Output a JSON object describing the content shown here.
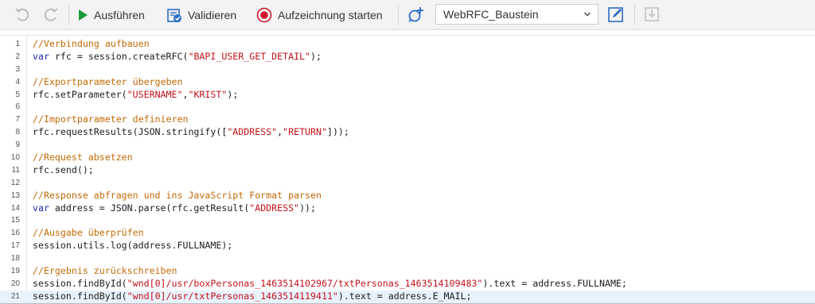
{
  "toolbar": {
    "run_label": "Ausführen",
    "validate_label": "Validieren",
    "record_label": "Aufzeichnung starten",
    "module_select_value": "WebRFC_Baustein"
  },
  "colors": {
    "comment": "#c16a06",
    "keyword": "#1b2fb0",
    "string": "#c1121a",
    "run_green": "#1a9b3a",
    "record_red": "#d0182a",
    "accent_blue": "#2b6cc4",
    "active_line": "#e8f2fc"
  },
  "editor": {
    "active_line": 21,
    "lines": [
      {
        "n": "1",
        "tokens": [
          {
            "t": "//Verbindung aufbauen",
            "c": "comment"
          }
        ]
      },
      {
        "n": "2",
        "tokens": [
          {
            "t": "var",
            "c": "kw"
          },
          {
            "t": " rfc = session.createRFC(",
            "c": ""
          },
          {
            "t": "\"BAPI_USER_GET_DETAIL\"",
            "c": "str"
          },
          {
            "t": ");",
            "c": ""
          }
        ]
      },
      {
        "n": "3",
        "tokens": []
      },
      {
        "n": "4",
        "tokens": [
          {
            "t": "//Exportparameter übergeben",
            "c": "comment"
          }
        ]
      },
      {
        "n": "5",
        "tokens": [
          {
            "t": "rfc.setParameter(",
            "c": ""
          },
          {
            "t": "\"USERNAME\"",
            "c": "str"
          },
          {
            "t": ",",
            "c": ""
          },
          {
            "t": "\"KRIST\"",
            "c": "str"
          },
          {
            "t": ");",
            "c": ""
          }
        ]
      },
      {
        "n": "6",
        "tokens": []
      },
      {
        "n": "7",
        "tokens": [
          {
            "t": "//Importparameter definieren",
            "c": "comment"
          }
        ]
      },
      {
        "n": "8",
        "tokens": [
          {
            "t": "rfc.requestResults(JSON.stringify([",
            "c": ""
          },
          {
            "t": "\"ADDRESS\"",
            "c": "str"
          },
          {
            "t": ",",
            "c": ""
          },
          {
            "t": "\"RETURN\"",
            "c": "str"
          },
          {
            "t": "]));",
            "c": ""
          }
        ]
      },
      {
        "n": "9",
        "tokens": []
      },
      {
        "n": "10",
        "tokens": [
          {
            "t": "//Request absetzen",
            "c": "comment"
          }
        ]
      },
      {
        "n": "11",
        "tokens": [
          {
            "t": "rfc.send();",
            "c": ""
          }
        ]
      },
      {
        "n": "12",
        "tokens": []
      },
      {
        "n": "13",
        "tokens": [
          {
            "t": "//Response abfragen und ins JavaScript Format parsen",
            "c": "comment"
          }
        ]
      },
      {
        "n": "14",
        "tokens": [
          {
            "t": "var",
            "c": "kw"
          },
          {
            "t": " address = JSON.parse(rfc.getResult(",
            "c": ""
          },
          {
            "t": "\"ADDRESS\"",
            "c": "str"
          },
          {
            "t": "));",
            "c": ""
          }
        ]
      },
      {
        "n": "15",
        "tokens": []
      },
      {
        "n": "16",
        "tokens": [
          {
            "t": "//Ausgabe überprüfen",
            "c": "comment"
          }
        ]
      },
      {
        "n": "17",
        "tokens": [
          {
            "t": "session.utils.log(address.FULLNAME);",
            "c": ""
          }
        ]
      },
      {
        "n": "18",
        "tokens": []
      },
      {
        "n": "19",
        "tokens": [
          {
            "t": "//Ergebnis zurückschreiben",
            "c": "comment"
          }
        ]
      },
      {
        "n": "20",
        "tokens": [
          {
            "t": "session.findById(",
            "c": ""
          },
          {
            "t": "\"wnd[0]/usr/boxPersonas_1463514102967/txtPersonas_1463514109483\"",
            "c": "str"
          },
          {
            "t": ").text = address.FULLNAME;",
            "c": ""
          }
        ]
      },
      {
        "n": "21",
        "tokens": [
          {
            "t": "session.findById(",
            "c": ""
          },
          {
            "t": "\"wnd[0]/usr/txtPersonas_1463514119411\"",
            "c": "str"
          },
          {
            "t": ").text = address.E_MAIL;",
            "c": ""
          }
        ]
      }
    ]
  }
}
